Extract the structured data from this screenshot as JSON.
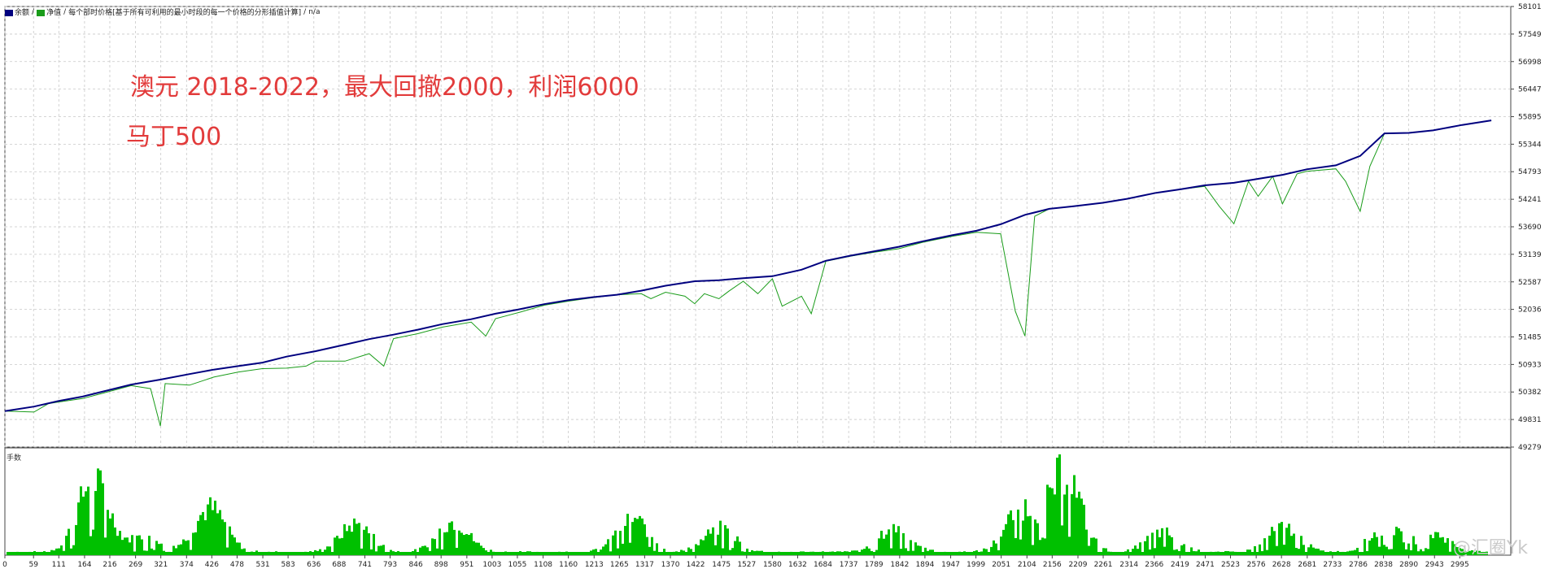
{
  "header": {
    "label1": "余额",
    "label2": "净值",
    "label3": "每个部时价格[基于所有可利用的最小时段的每一个价格的分形插值计算]",
    "label4": "n/a"
  },
  "annotation": {
    "line1": "澳元 2018-2022，最大回撤2000，利润6000",
    "line2": "马丁500"
  },
  "lower_panel": {
    "title": "手数"
  },
  "watermark": "@汇圈Yk",
  "colors": {
    "balance": "#00007f",
    "equity": "#1a9c1a",
    "volume": "#00c000",
    "grid": "#c8c8c8",
    "annotation": "#e23b3b"
  },
  "chart_data": [
    {
      "type": "line",
      "ylim": [
        49279,
        58101
      ],
      "xlim": [
        0,
        3100
      ],
      "y_ticks": [
        58101,
        57549,
        56998,
        56447,
        55895,
        55344,
        54793,
        54241,
        53690,
        53139,
        52587,
        52036,
        51485,
        50933,
        50382,
        49831,
        49279
      ],
      "x_ticks": [
        0,
        59,
        111,
        164,
        216,
        269,
        321,
        374,
        426,
        478,
        531,
        583,
        636,
        688,
        741,
        793,
        846,
        898,
        951,
        1003,
        1055,
        1108,
        1160,
        1213,
        1265,
        1317,
        1370,
        1422,
        1475,
        1527,
        1580,
        1632,
        1684,
        1737,
        1789,
        1842,
        1894,
        1947,
        1999,
        2051,
        2104,
        2156,
        2209,
        2261,
        2314,
        2366,
        2419,
        2471,
        2523,
        2576,
        2628,
        2681,
        2733,
        2786,
        2838,
        2890,
        2943,
        2995
      ],
      "series": [
        {
          "name": "余额",
          "x": [
            0,
            60,
            110,
            160,
            210,
            260,
            320,
            380,
            430,
            480,
            530,
            580,
            640,
            700,
            750,
            800,
            850,
            900,
            960,
            1010,
            1060,
            1110,
            1160,
            1210,
            1260,
            1310,
            1360,
            1420,
            1470,
            1520,
            1580,
            1640,
            1690,
            1740,
            1790,
            1840,
            1890,
            1950,
            2000,
            2050,
            2100,
            2150,
            2200,
            2260,
            2310,
            2370,
            2420,
            2470,
            2530,
            2580,
            2630,
            2680,
            2740,
            2790,
            2840,
            2890,
            2940,
            3000,
            3060
          ],
          "values": [
            50000,
            50090,
            50200,
            50290,
            50410,
            50530,
            50630,
            50740,
            50830,
            50900,
            50970,
            51090,
            51200,
            51330,
            51440,
            51530,
            51630,
            51740,
            51840,
            51950,
            52040,
            52140,
            52220,
            52280,
            52330,
            52410,
            52510,
            52600,
            52620,
            52660,
            52700,
            52830,
            53010,
            53110,
            53200,
            53290,
            53400,
            53520,
            53610,
            53740,
            53930,
            54050,
            54100,
            54170,
            54250,
            54370,
            54440,
            54520,
            54570,
            54650,
            54730,
            54840,
            54920,
            55110,
            55560,
            55570,
            55620,
            55730,
            55820
          ]
        },
        {
          "name": "净值",
          "x": [
            0,
            60,
            90,
            110,
            160,
            210,
            260,
            300,
            320,
            330,
            380,
            430,
            480,
            530,
            580,
            620,
            640,
            700,
            750,
            780,
            800,
            850,
            900,
            960,
            990,
            1010,
            1060,
            1110,
            1160,
            1210,
            1260,
            1310,
            1330,
            1360,
            1400,
            1420,
            1440,
            1470,
            1490,
            1520,
            1550,
            1580,
            1600,
            1640,
            1660,
            1690,
            1740,
            1790,
            1840,
            1890,
            1950,
            2000,
            2050,
            2080,
            2100,
            2120,
            2150,
            2200,
            2260,
            2310,
            2370,
            2420,
            2470,
            2500,
            2530,
            2560,
            2580,
            2610,
            2630,
            2660,
            2680,
            2740,
            2760,
            2790,
            2810,
            2840,
            2890,
            2940,
            3000,
            3060
          ],
          "values": [
            50000,
            49980,
            50150,
            50180,
            50250,
            50380,
            50510,
            50450,
            49700,
            50550,
            50520,
            50680,
            50780,
            50850,
            50860,
            50900,
            51000,
            51000,
            51150,
            50900,
            51450,
            51550,
            51680,
            51780,
            51500,
            51850,
            51980,
            52120,
            52200,
            52270,
            52330,
            52350,
            52250,
            52380,
            52300,
            52150,
            52350,
            52250,
            52400,
            52600,
            52350,
            52650,
            52100,
            52300,
            51950,
            53000,
            53100,
            53180,
            53250,
            53380,
            53500,
            53580,
            53550,
            52000,
            51500,
            53900,
            54050,
            54100,
            54170,
            54250,
            54370,
            54440,
            54500,
            54100,
            53750,
            54600,
            54300,
            54700,
            54150,
            54750,
            54800,
            54850,
            54600,
            54000,
            54900,
            55560,
            55570,
            55620,
            55730,
            55820
          ]
        }
      ]
    },
    {
      "type": "bar",
      "title": "手数"
    }
  ]
}
